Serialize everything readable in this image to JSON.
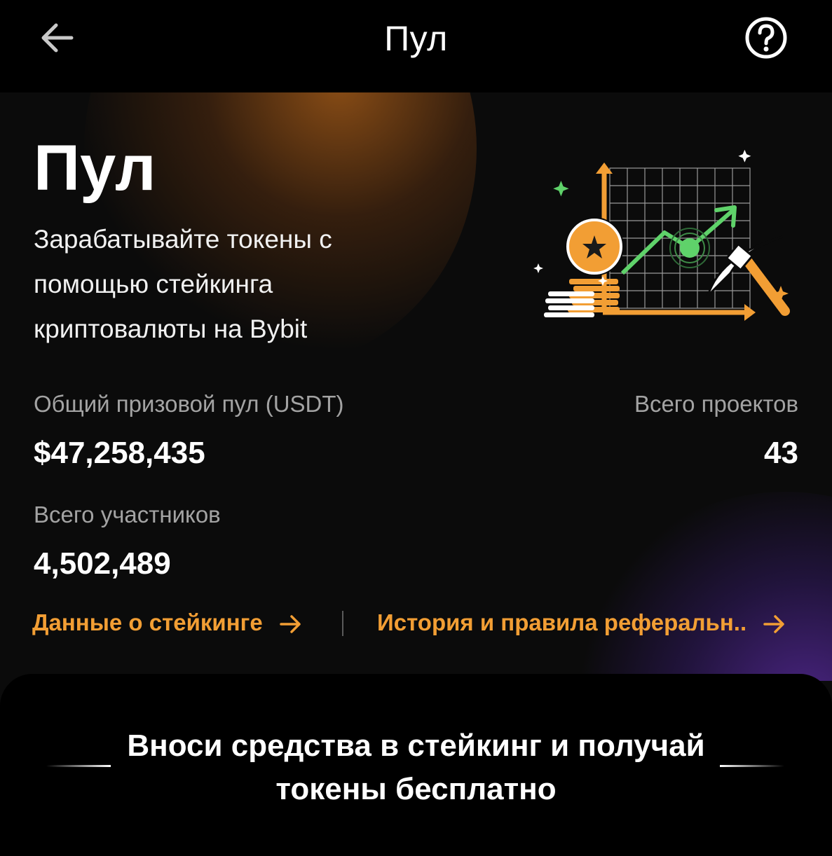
{
  "header": {
    "title": "Пул",
    "back_icon": "arrow-left-icon",
    "help_icon": "question-circle-icon"
  },
  "hero": {
    "title": "Пул",
    "subtitle": "Зарабатывайте токены с помощью стейкинга криптовалюты на Bybit",
    "illustration": "mining-growth-chart-illustration"
  },
  "stats": {
    "prize_pool_label": "Общий призовой пул (USDT)",
    "prize_pool_value": "$47,258,435",
    "projects_label": "Всего проектов",
    "projects_value": "43",
    "participants_label": "Всего участников",
    "participants_value": "4,502,489"
  },
  "links": {
    "staking_data": "Данные о стейкинге",
    "referral_history": "История и правила реферальн.."
  },
  "banner": {
    "text": "Вноси средства в стейкинг и получай токены бесплатно"
  },
  "colors": {
    "accent": "#f29e34",
    "green": "#5fd26a",
    "purple": "#5f2daa",
    "background": "#0b0b0b"
  }
}
